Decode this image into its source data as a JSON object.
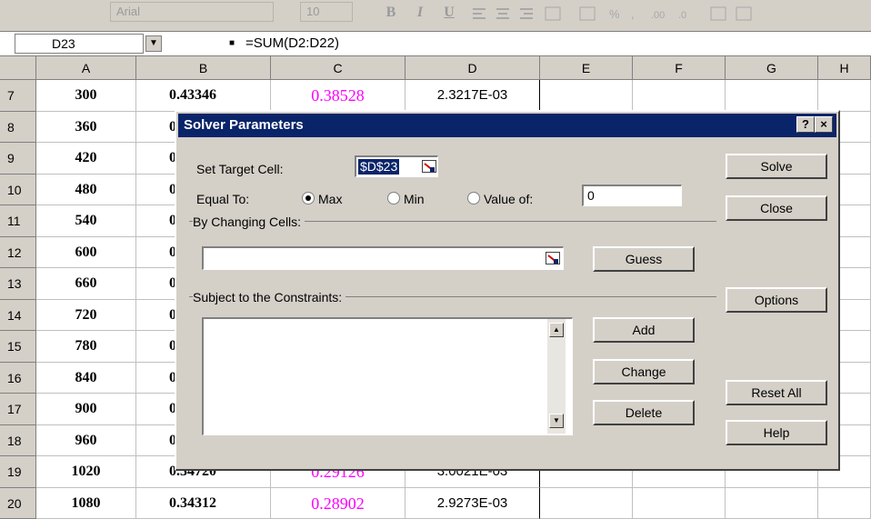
{
  "toolbar": {
    "font_name": "Arial",
    "font_size": "10",
    "buttons": [
      "B",
      "I",
      "U"
    ]
  },
  "formula_bar": {
    "name_box": "D23",
    "formula": "=SUM(D2:D22)"
  },
  "columns": [
    "A",
    "B",
    "C",
    "D",
    "E",
    "F",
    "G",
    "H"
  ],
  "rows": [
    {
      "num": "7",
      "a": "300",
      "b": "0.43346",
      "c": "0.38528",
      "d": "2.3217E-03"
    },
    {
      "num": "8",
      "a": "360",
      "b": "0",
      "c": "",
      "d": ""
    },
    {
      "num": "9",
      "a": "420",
      "b": "0",
      "c": "",
      "d": ""
    },
    {
      "num": "10",
      "a": "480",
      "b": "0",
      "c": "",
      "d": ""
    },
    {
      "num": "11",
      "a": "540",
      "b": "0",
      "c": "",
      "d": ""
    },
    {
      "num": "12",
      "a": "600",
      "b": "0",
      "c": "",
      "d": ""
    },
    {
      "num": "13",
      "a": "660",
      "b": "0",
      "c": "",
      "d": ""
    },
    {
      "num": "14",
      "a": "720",
      "b": "0",
      "c": "",
      "d": ""
    },
    {
      "num": "15",
      "a": "780",
      "b": "0",
      "c": "",
      "d": ""
    },
    {
      "num": "16",
      "a": "840",
      "b": "0",
      "c": "",
      "d": ""
    },
    {
      "num": "17",
      "a": "900",
      "b": "0",
      "c": "",
      "d": ""
    },
    {
      "num": "18",
      "a": "960",
      "b": "0",
      "c": "",
      "d": ""
    },
    {
      "num": "19",
      "a": "1020",
      "b": "0.34720",
      "c": "0.29126",
      "d": "3.0021E-03"
    },
    {
      "num": "20",
      "a": "1080",
      "b": "0.34312",
      "c": "0.28902",
      "d": "2.9273E-03"
    }
  ],
  "dialog": {
    "title": "Solver Parameters",
    "help_button": "?",
    "close_button": "×",
    "target_label": "Set Target Cell:",
    "target_value": "$D$23",
    "equal_label": "Equal To:",
    "opt_max": "Max",
    "opt_min": "Min",
    "opt_value": "Value of:",
    "value_of": "0",
    "selected_option": "max",
    "changing_label": "By Changing Cells:",
    "changing_value": "",
    "constraints_label": "Subject to the Constraints:",
    "constraints": [],
    "btn_solve": "Solve",
    "btn_close": "Close",
    "btn_guess": "Guess",
    "btn_options": "Options",
    "btn_add": "Add",
    "btn_change": "Change",
    "btn_delete": "Delete",
    "btn_reset": "Reset All",
    "btn_help": "Help"
  },
  "colors": {
    "dialog_face": "#d4d0c8",
    "title_bar": "#0a246a",
    "magenta_values": "#ff00ff"
  },
  "icons": [
    "name-box-dropdown-icon",
    "range-picker-icon",
    "scroll-up-arrow-icon",
    "scroll-down-arrow-icon"
  ]
}
